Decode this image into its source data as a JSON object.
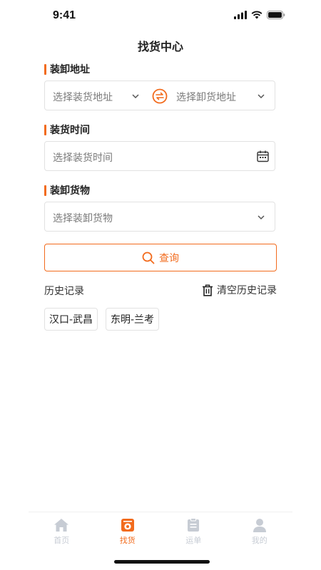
{
  "status_bar": {
    "time": "9:41"
  },
  "header": {
    "title": "找货中心"
  },
  "sections": {
    "route": {
      "label": "装卸地址",
      "load_placeholder": "选择装货地址",
      "unload_placeholder": "选择卸货地址"
    },
    "time": {
      "label": "装货时间",
      "placeholder": "选择装货时间"
    },
    "cargo": {
      "label": "装卸货物",
      "placeholder": "选择装卸货物"
    }
  },
  "search_button": {
    "label": "查询"
  },
  "history": {
    "title": "历史记录",
    "clear_label": "清空历史记录",
    "items": [
      "汉口-武昌",
      "东明-兰考"
    ]
  },
  "tabbar": {
    "tabs": [
      {
        "label": "首页",
        "icon": "home-icon",
        "active": false
      },
      {
        "label": "找货",
        "icon": "find-cargo-icon",
        "active": true
      },
      {
        "label": "运单",
        "icon": "waybill-icon",
        "active": false
      },
      {
        "label": "我的",
        "icon": "user-icon",
        "active": false
      }
    ]
  },
  "colors": {
    "accent": "#f26b1d",
    "inactive_tab": "#c7ccd4",
    "border": "#e2e2e2"
  }
}
